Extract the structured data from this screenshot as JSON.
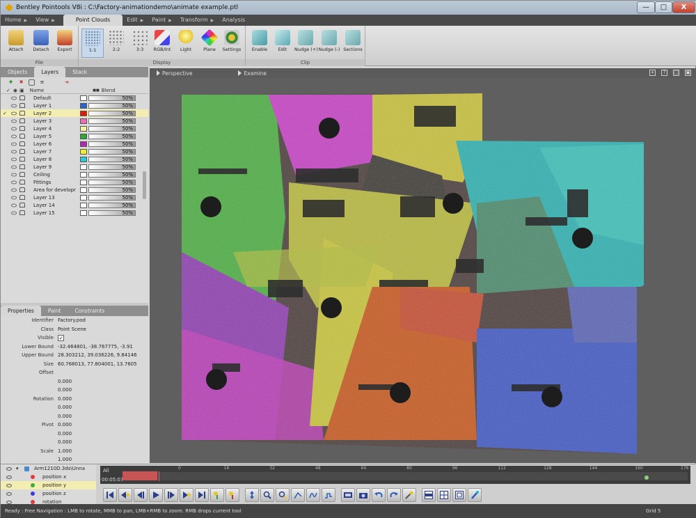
{
  "window": {
    "title": "Bentley Pointools V8i  :  C:\\Factory-animationdemo\\animate example.ptl",
    "minimize": "—",
    "maximize": "□",
    "close": "X"
  },
  "menu": [
    {
      "label": "Home",
      "active": false
    },
    {
      "label": "View",
      "active": false
    },
    {
      "label": "Point Clouds",
      "active": true
    },
    {
      "label": "Edit",
      "active": false
    },
    {
      "label": "Paint",
      "active": false
    },
    {
      "label": "Transform",
      "active": false
    },
    {
      "label": "Analysis",
      "active": false
    }
  ],
  "ribbon": {
    "groups": [
      {
        "label": "File",
        "buttons": [
          "Attach",
          "Detach",
          "Export"
        ]
      },
      {
        "label": "Display",
        "buttons": [
          "1:1",
          "2:2",
          "3:3",
          "RGB/Int",
          "Light",
          "Plane",
          "Settings"
        ]
      },
      {
        "label": "Clip",
        "buttons": [
          "Enable",
          "Edit",
          "Nudge (+)",
          "Nudge (-)",
          "Sections"
        ]
      }
    ]
  },
  "panel_tabs": [
    "Objects",
    "Layers",
    "Stack"
  ],
  "layers": {
    "col_name": "Name",
    "col_blend": "Blend",
    "rows": [
      {
        "name": "Default",
        "color": "#ffffff",
        "blend": "50%",
        "checked": false,
        "selected": false
      },
      {
        "name": "Layer 1",
        "color": "#2a62d4",
        "blend": "50%",
        "checked": false,
        "selected": false
      },
      {
        "name": "Layer 2",
        "color": "#e01818",
        "blend": "50%",
        "checked": true,
        "selected": true
      },
      {
        "name": "Layer 3",
        "color": "#f06ab4",
        "blend": "50%",
        "checked": false,
        "selected": false
      },
      {
        "name": "Layer 4",
        "color": "#f2f2a0",
        "blend": "50%",
        "checked": false,
        "selected": false
      },
      {
        "name": "Layer 5",
        "color": "#2ea82e",
        "blend": "50%",
        "checked": false,
        "selected": false
      },
      {
        "name": "Layer 6",
        "color": "#b02ab0",
        "blend": "50%",
        "checked": false,
        "selected": false
      },
      {
        "name": "Layer 7",
        "color": "#f2f020",
        "blend": "50%",
        "checked": false,
        "selected": false
      },
      {
        "name": "Layer 8",
        "color": "#2ec8d0",
        "blend": "50%",
        "checked": false,
        "selected": false
      },
      {
        "name": "Layer 9",
        "color": "#ffffff",
        "blend": "50%",
        "checked": false,
        "selected": false
      },
      {
        "name": "Ceiling",
        "color": "#ffffff",
        "blend": "50%",
        "checked": false,
        "selected": false
      },
      {
        "name": "Fittings",
        "color": "#ffffff",
        "blend": "50%",
        "checked": false,
        "selected": false
      },
      {
        "name": "Area for developr",
        "color": "#ffffff",
        "blend": "50%",
        "checked": false,
        "selected": false
      },
      {
        "name": "Layer 13",
        "color": "#ffffff",
        "blend": "50%",
        "checked": false,
        "selected": false
      },
      {
        "name": "Layer 14",
        "color": "#ffffff",
        "blend": "50%",
        "checked": false,
        "selected": false
      },
      {
        "name": "Layer 15",
        "color": "#ffffff",
        "blend": "50%",
        "checked": false,
        "selected": false
      }
    ]
  },
  "props_tabs": [
    "Properties",
    "Paint",
    "Constraints"
  ],
  "properties": [
    {
      "key": "Identifier",
      "value": "Factory.pod"
    },
    {
      "key": "Class",
      "value": "Point Scene"
    },
    {
      "key": "Visible",
      "value": "✓",
      "checkbox": true
    },
    {
      "key": "Lower Bound",
      "value": "-32.464801, -38.767775, -3.91"
    },
    {
      "key": "Upper Bound",
      "value": "28.303212, 39.036226, 9.84146"
    },
    {
      "key": "Size",
      "value": "60.768013, 77.804001, 13.7605"
    },
    {
      "key": "Offset",
      "value": ""
    },
    {
      "key": "",
      "value": "0.000"
    },
    {
      "key": "",
      "value": "0.000"
    },
    {
      "key": "Rotation",
      "value": "0.000"
    },
    {
      "key": "",
      "value": "0.000"
    },
    {
      "key": "",
      "value": "0.000"
    },
    {
      "key": "Pivot",
      "value": "0.000"
    },
    {
      "key": "",
      "value": "0.000"
    },
    {
      "key": "",
      "value": "0.000"
    },
    {
      "key": "Scale",
      "value": "1.000"
    },
    {
      "key": "",
      "value": "1.000"
    }
  ],
  "viewport": {
    "tabs": [
      "Perspective",
      "Examine"
    ],
    "icons": [
      "+",
      "?",
      "□",
      "▣"
    ]
  },
  "animation": {
    "channels": [
      {
        "label": "Arm1210D.3ds\\Unna",
        "dot": ""
      },
      {
        "label": "position x",
        "dot": "#e03a3a",
        "selected": false
      },
      {
        "label": "position y",
        "dot": "#3aa83a",
        "selected": true
      },
      {
        "label": "position z",
        "dot": "#3a3ad8",
        "selected": false
      },
      {
        "label": "rotation",
        "dot": "#e03a3a",
        "selected": false
      }
    ],
    "all_label": "All",
    "time": "00:05:07",
    "ticks": [
      "0",
      "16",
      "32",
      "48",
      "64",
      "80",
      "96",
      "112",
      "128",
      "144",
      "160",
      "176"
    ],
    "marker_position_frames": 164
  },
  "status": {
    "text": "Ready : Free Navigation : LMB to rotate, MMB to pan, LMB+RMB to zoom. RMB drops current tool",
    "grid": "Grid 5"
  }
}
